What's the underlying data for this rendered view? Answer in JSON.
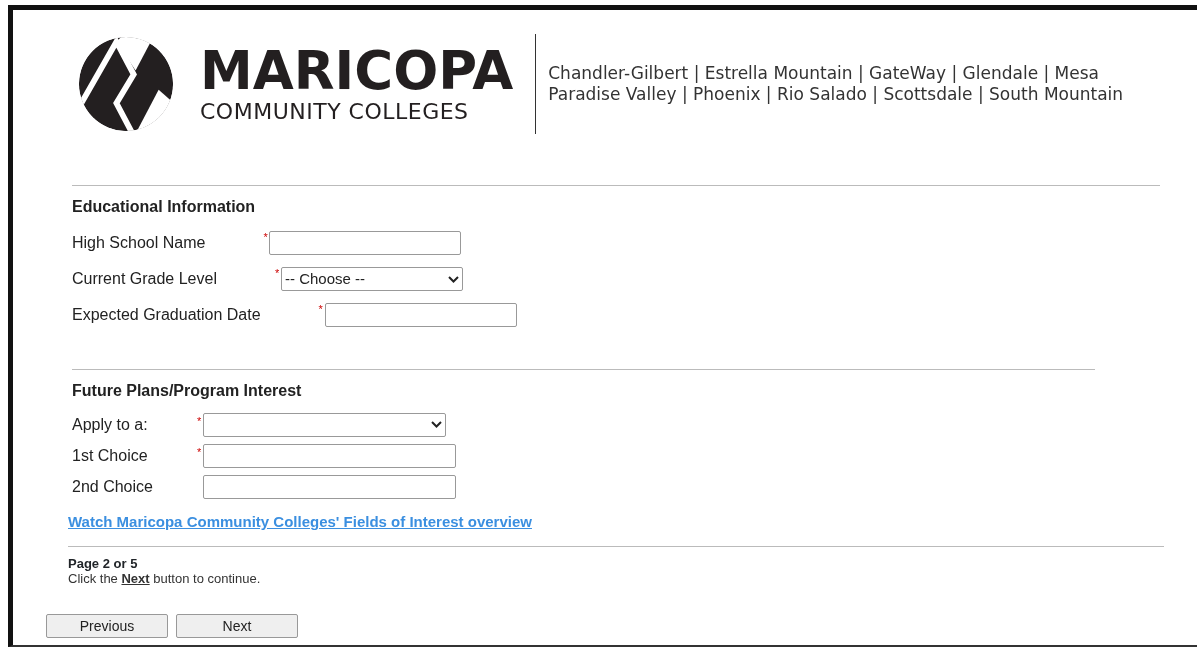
{
  "header": {
    "logo_name": "MARICOPA",
    "logo_subtitle": "COMMUNITY COLLEGES",
    "colleges_lines": [
      "Chandler-Gilbert | Estrella Mountain | GateWay | Glendale | Mesa",
      "Paradise Valley | Phoenix | Rio Salado | Scottsdale | South Mountain"
    ]
  },
  "sections": [
    {
      "title": "Educational Information",
      "fields": [
        {
          "label": "High School Name",
          "kind": "text",
          "required_mark": "*"
        },
        {
          "label": "Current Grade Level",
          "kind": "select",
          "required_mark": "*",
          "value": "-- Choose --"
        },
        {
          "label": "Expected Graduation Date",
          "kind": "text",
          "required_mark": "*"
        }
      ]
    },
    {
      "title": "Future Plans/Program Interest",
      "fields": [
        {
          "label": "Apply to a:",
          "kind": "select",
          "required_mark": "*"
        },
        {
          "label": "1st Choice",
          "kind": "text",
          "required_mark": "*"
        },
        {
          "label": "2nd Choice",
          "kind": "text"
        }
      ]
    }
  ],
  "link": "Watch Maricopa Community Colleges' Fields of Interest overview",
  "page_indicator": "Page 2 or 5",
  "instruction": "Click the **Next** button to continue.",
  "buttons": [
    "Previous",
    "Next"
  ]
}
